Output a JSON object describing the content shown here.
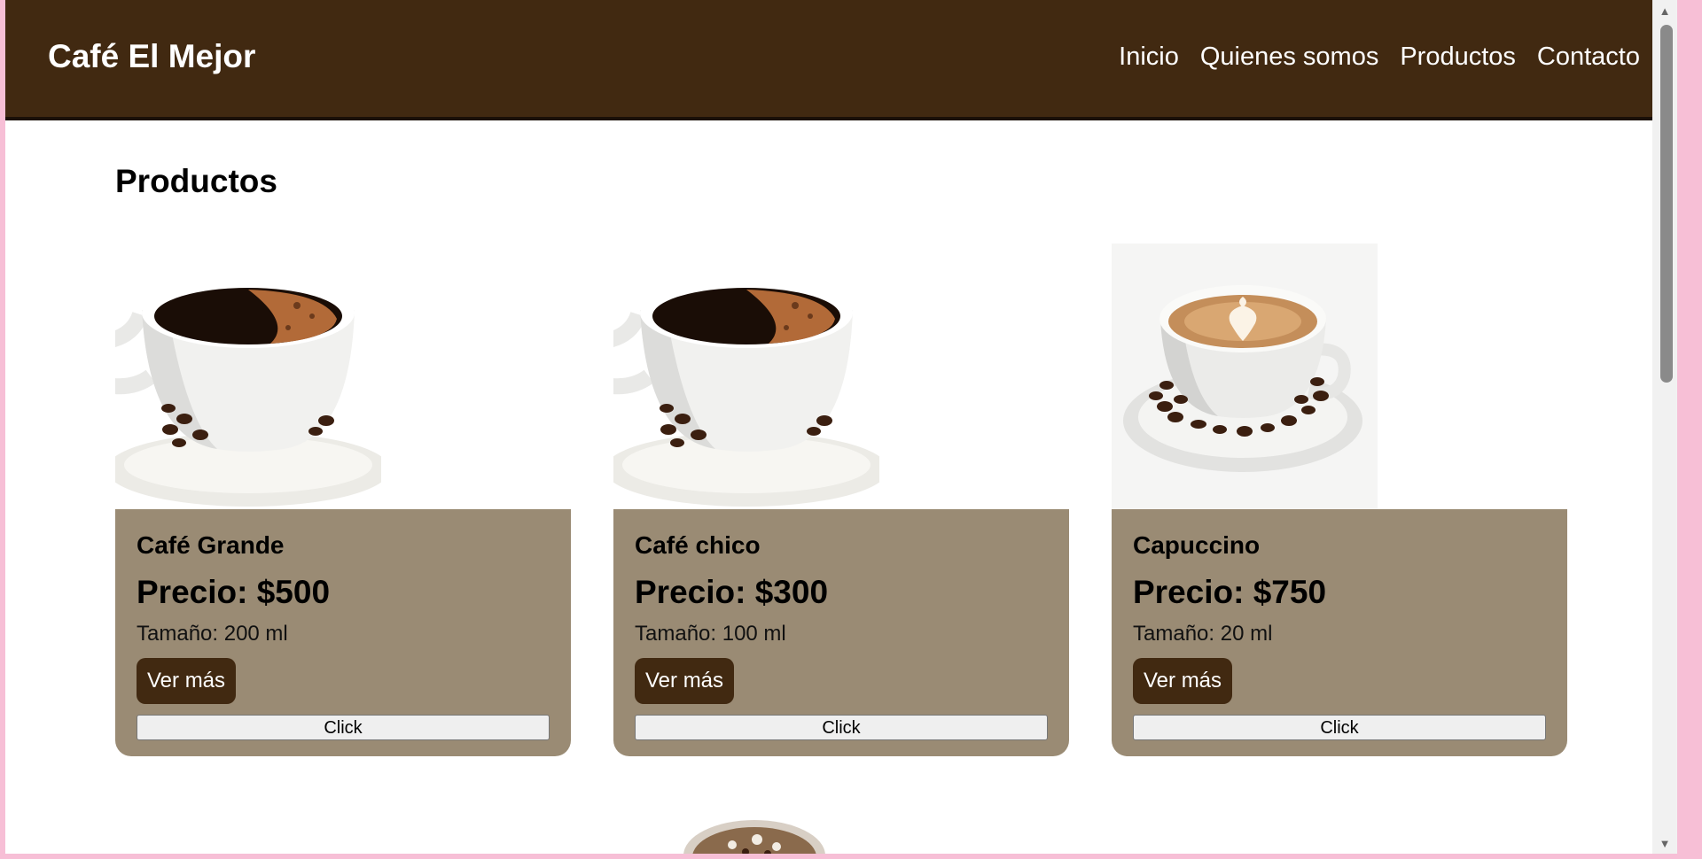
{
  "header": {
    "brand": "Café El Mejor",
    "nav": [
      "Inicio",
      "Quienes somos",
      "Productos",
      "Contacto"
    ]
  },
  "main": {
    "title": "Productos",
    "products": [
      {
        "name": "Café Grande",
        "price": "Precio: $500",
        "size": "Tamaño: 200 ml",
        "more_label": "Ver más",
        "click_label": "Click",
        "image": "black-coffee-cup"
      },
      {
        "name": "Café chico",
        "price": "Precio: $300",
        "size": "Tamaño: 100 ml",
        "more_label": "Ver más",
        "click_label": "Click",
        "image": "black-coffee-cup"
      },
      {
        "name": "Capuccino",
        "price": "Precio: $750",
        "size": "Tamaño: 20 ml",
        "more_label": "Ver más",
        "click_label": "Click",
        "image": "cappuccino-latte-art-cup"
      }
    ]
  },
  "colors": {
    "header_bg": "#412911",
    "card_bg": "#9a8b74",
    "button_bg": "#412911",
    "window_frame": "#f7bfd6"
  },
  "scrollbar": {
    "up_icon": "triangle-up-icon",
    "down_icon": "triangle-down-icon"
  }
}
